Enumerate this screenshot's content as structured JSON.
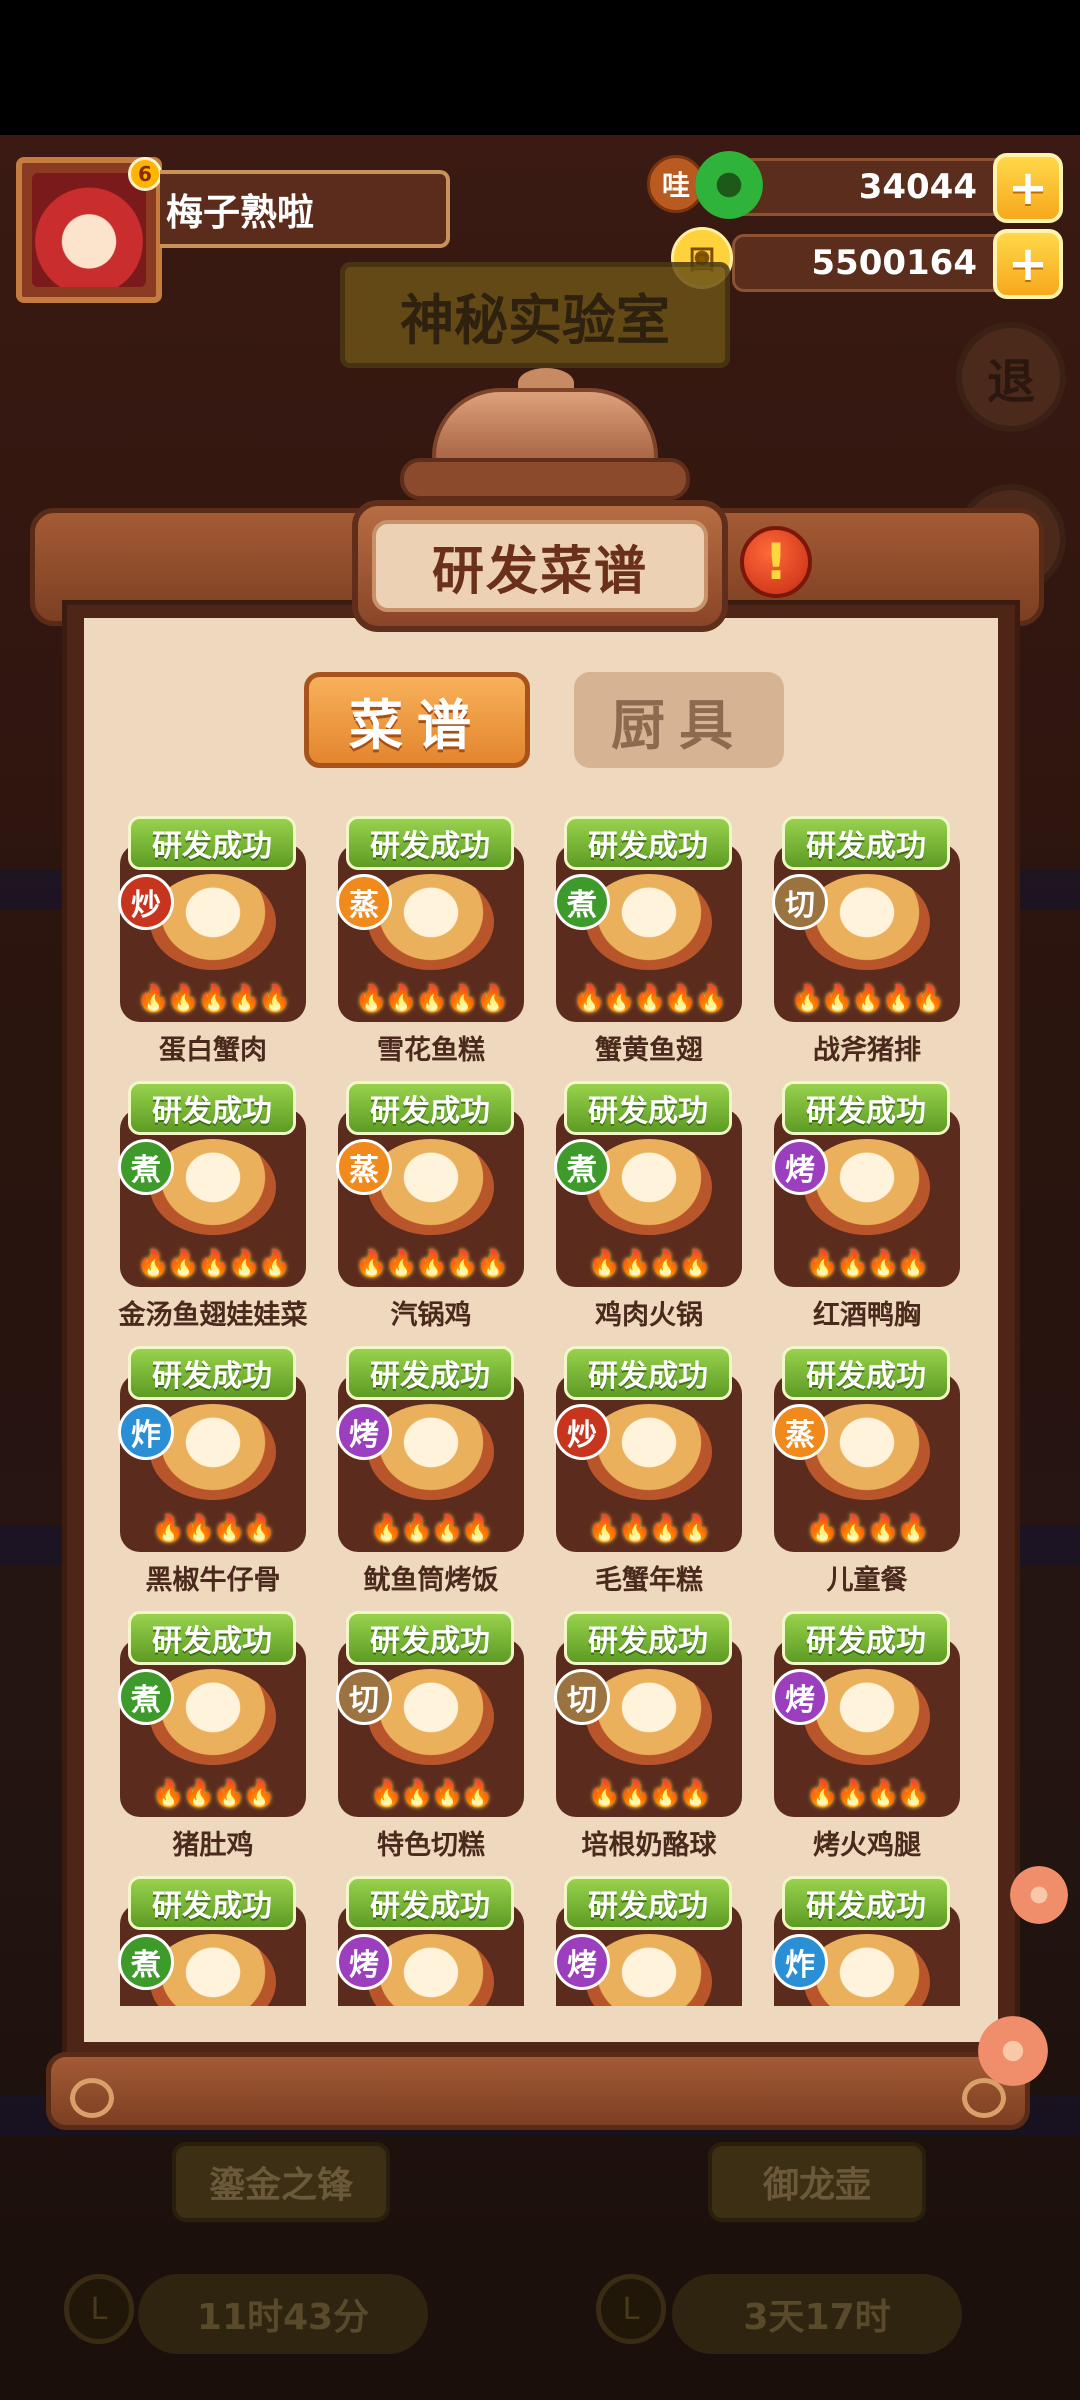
{
  "player": {
    "name": "梅子熟啦",
    "avatar_badge": "6"
  },
  "currency": {
    "jade": {
      "prefix": "哇",
      "value": "34044"
    },
    "coins": {
      "symbol": "回",
      "value": "5500164"
    },
    "plus_label": "+"
  },
  "background": {
    "lab_title": "神秘实验室",
    "exit_label": "退"
  },
  "panel": {
    "title": "研发菜谱",
    "alert_glyph": "!",
    "tabs": {
      "recipes": "菜谱",
      "utensils": "厨具"
    }
  },
  "colors": {
    "chao": "#c7351f",
    "zheng": "#f08a1c",
    "zhu": "#3f9a2c",
    "qie": "#9a7340",
    "kao": "#9b3fbf",
    "zha": "#2b8fd6"
  },
  "recipes": [
    {
      "status": "研发成功",
      "method": "炒",
      "method_key": "chao",
      "name": "蛋白蟹肉",
      "flames": "🔥🔥🔥🔥🔥"
    },
    {
      "status": "研发成功",
      "method": "蒸",
      "method_key": "zheng",
      "name": "雪花鱼糕",
      "flames": "🔥🔥🔥🔥🔥"
    },
    {
      "status": "研发成功",
      "method": "煮",
      "method_key": "zhu",
      "name": "蟹黄鱼翅",
      "flames": "🔥🔥🔥🔥🔥"
    },
    {
      "status": "研发成功",
      "method": "切",
      "method_key": "qie",
      "name": "战斧猪排",
      "flames": "🔥🔥🔥🔥🔥"
    },
    {
      "status": "研发成功",
      "method": "煮",
      "method_key": "zhu",
      "name": "金汤鱼翅娃娃菜",
      "flames": "🔥🔥🔥🔥🔥"
    },
    {
      "status": "研发成功",
      "method": "蒸",
      "method_key": "zheng",
      "name": "汽锅鸡",
      "flames": "🔥🔥🔥🔥🔥"
    },
    {
      "status": "研发成功",
      "method": "煮",
      "method_key": "zhu",
      "name": "鸡肉火锅",
      "flames": "🔥🔥🔥🔥"
    },
    {
      "status": "研发成功",
      "method": "烤",
      "method_key": "kao",
      "name": "红酒鸭胸",
      "flames": "🔥🔥🔥🔥"
    },
    {
      "status": "研发成功",
      "method": "炸",
      "method_key": "zha",
      "name": "黑椒牛仔骨",
      "flames": "🔥🔥🔥🔥"
    },
    {
      "status": "研发成功",
      "method": "烤",
      "method_key": "kao",
      "name": "鱿鱼筒烤饭",
      "flames": "🔥🔥🔥🔥"
    },
    {
      "status": "研发成功",
      "method": "炒",
      "method_key": "chao",
      "name": "毛蟹年糕",
      "flames": "🔥🔥🔥🔥"
    },
    {
      "status": "研发成功",
      "method": "蒸",
      "method_key": "zheng",
      "name": "儿童餐",
      "flames": "🔥🔥🔥🔥"
    },
    {
      "status": "研发成功",
      "method": "煮",
      "method_key": "zhu",
      "name": "猪肚鸡",
      "flames": "🔥🔥🔥🔥"
    },
    {
      "status": "研发成功",
      "method": "切",
      "method_key": "qie",
      "name": "特色切糕",
      "flames": "🔥🔥🔥🔥"
    },
    {
      "status": "研发成功",
      "method": "切",
      "method_key": "qie",
      "name": "培根奶酪球",
      "flames": "🔥🔥🔥🔥"
    },
    {
      "status": "研发成功",
      "method": "烤",
      "method_key": "kao",
      "name": "烤火鸡腿",
      "flames": "🔥🔥🔥🔥"
    },
    {
      "status": "研发成功",
      "method": "煮",
      "method_key": "zhu",
      "name": "",
      "flames": ""
    },
    {
      "status": "研发成功",
      "method": "烤",
      "method_key": "kao",
      "name": "",
      "flames": ""
    },
    {
      "status": "研发成功",
      "method": "烤",
      "method_key": "kao",
      "name": "",
      "flames": ""
    },
    {
      "status": "研发成功",
      "method": "炸",
      "method_key": "zha",
      "name": "",
      "flames": ""
    }
  ],
  "bottom": {
    "left_item": "鎏金之锋",
    "right_item": "御龙壶",
    "left_timer": "11时43分",
    "right_timer": "3天17时",
    "clock_glyph": "L"
  }
}
